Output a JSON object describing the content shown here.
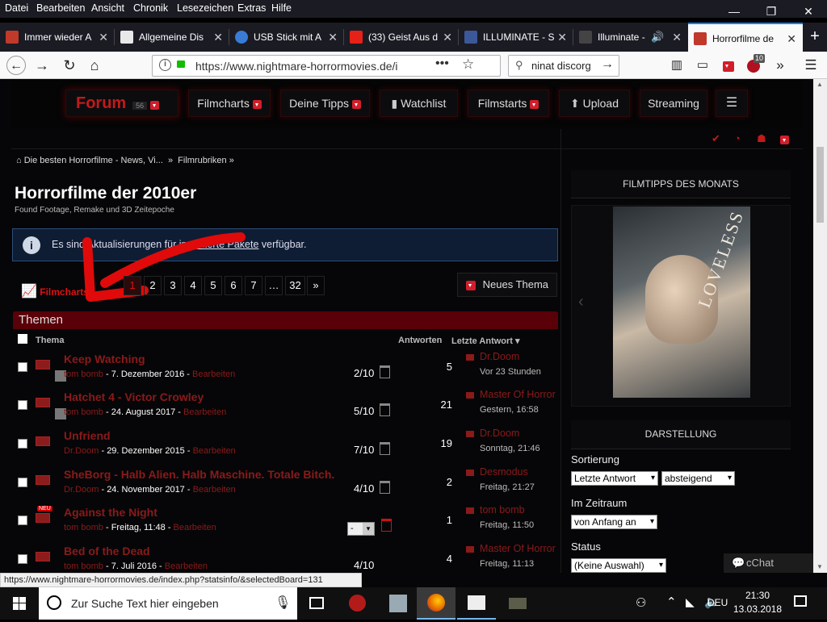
{
  "menubar": {
    "items": [
      {
        "pre": "D",
        "u": "a",
        "post": "tei"
      },
      {
        "pre": "",
        "u": "B",
        "post": "earbeiten"
      },
      {
        "pre": "",
        "u": "A",
        "post": "nsicht"
      },
      {
        "pre": "",
        "u": "C",
        "post": "hronik"
      },
      {
        "pre": "",
        "u": "L",
        "post": "esezeichen"
      },
      {
        "pre": "E",
        "u": "x",
        "post": "tras"
      },
      {
        "pre": "",
        "u": "H",
        "post": "ilfe"
      }
    ],
    "labels": [
      "Datei",
      "Bearbeiten",
      "Ansicht",
      "Chronik",
      "Lesezeichen",
      "Extras",
      "Hilfe"
    ]
  },
  "window": {
    "minimize": "—",
    "restore": "❐",
    "close": "✕"
  },
  "tabs": [
    {
      "label": "Immer wieder A",
      "color": "#c0392b"
    },
    {
      "label": "Allgemeine Dis",
      "color": "#e8e8e8"
    },
    {
      "label": "USB Stick mit A",
      "color": "#3a7bd5"
    },
    {
      "label": "(33) Geist Aus d",
      "color": "#e62117"
    },
    {
      "label": "ILLUMINATE - S",
      "color": "#3b5998"
    },
    {
      "label": "Illuminate -",
      "color": "#222"
    },
    {
      "label": "Horrorfilme de",
      "color": "#c0392b"
    }
  ],
  "new_tab": "+",
  "navbar": {
    "url": "https://www.nightmare-horrormovies.de/i",
    "search_value": "ninat discorg",
    "ublock_count": "10"
  },
  "site_nav": {
    "forum": "Forum",
    "forum_count": "56",
    "items": [
      "Filmcharts",
      "Deine Tipps",
      "Watchlist",
      "Filmstarts",
      "Upload",
      "Streaming"
    ]
  },
  "breadcrumb": {
    "home": "Die besten Horrorfilme - News, Vi...",
    "sep": "»",
    "second": "Filmrubriken"
  },
  "board": {
    "title": "Horrorfilme der 2010er",
    "subtitle": "Found Footage, Remake und 3D Zeitepoche"
  },
  "info": {
    "prefix": "Es sind ",
    "mid1": "Aktualisierungen",
    "mid2": " für ",
    "link": "installierte Pakete",
    "suffix": " verfügbar."
  },
  "toolbar": {
    "filmcharts": "Filmcharts",
    "pages": [
      "1",
      "2",
      "3",
      "4",
      "5",
      "6",
      "7",
      "…",
      "32",
      "»"
    ],
    "new_thread": "Neues Thema"
  },
  "table": {
    "section": "Themen",
    "col_topic": "Thema",
    "col_answers": "Antworten",
    "col_last": "Letzte Antwort",
    "rows": [
      {
        "title": "Keep Watching",
        "author": "tom bomb",
        "date": "7. Dezember 2016",
        "edit": "Bearbeiten",
        "rating": "2/10",
        "answers": "5",
        "last_user": "Dr.Doom",
        "last_date": "Vor 23 Stunden"
      },
      {
        "title": "Hatchet 4 - Victor Crowley",
        "author": "tom bomb",
        "date": "24. August 2017",
        "edit": "Bearbeiten",
        "rating": "5/10",
        "answers": "21",
        "last_user": "Master Of Horror",
        "last_date": "Gestern, 16:58"
      },
      {
        "title": "Unfriend",
        "author": "Dr.Doom",
        "date": "29. Dezember 2015",
        "edit": "Bearbeiten",
        "rating": "7/10",
        "answers": "19",
        "last_user": "Dr.Doom",
        "last_date": "Sonntag, 21:46"
      },
      {
        "title": "SheBorg - Halb Alien. Halb Maschine. Totale Bitch.",
        "author": "Dr.Doom",
        "date": "24. November 2017",
        "edit": "Bearbeiten",
        "rating": "4/10",
        "answers": "2",
        "last_user": "Desmodus",
        "last_date": "Freitag, 21:27"
      },
      {
        "title": "Against the Night",
        "author": "tom bomb",
        "date": "Freitag, 11:48",
        "edit": "Bearbeiten",
        "rating": "-",
        "answers": "1",
        "last_user": "tom bomb",
        "last_date": "Freitag, 11:50",
        "badge": "NEU"
      },
      {
        "title": "Bed of the Dead",
        "author": "tom bomb",
        "date": "7. Juli 2016",
        "edit": "Bearbeiten",
        "rating": "4/10",
        "answers": "4",
        "last_user": "Master Of Horror",
        "last_date": "Freitag, 11:13"
      }
    ]
  },
  "sidebar": {
    "tipps_title": "FILMTIPPS DES MONATS",
    "poster_text": "LOVELESS",
    "darstellung": "DARSTELLUNG",
    "sort_label": "Sortierung",
    "sort_value": "Letzte Antwort",
    "order_value": "absteigend",
    "range_label": "Im Zeitraum",
    "range_value": "von Anfang an",
    "status_label": "Status",
    "status_value": "(Keine Auswahl)",
    "chat": "cChat"
  },
  "statusbar": "https://www.nightmare-horrormovies.de/index.php?statsinfo/&selectedBoard=131",
  "taskbar": {
    "search_placeholder": "Zur Suche Text hier eingeben",
    "lang": "DEU",
    "time": "21:30",
    "date": "13.03.2018"
  }
}
